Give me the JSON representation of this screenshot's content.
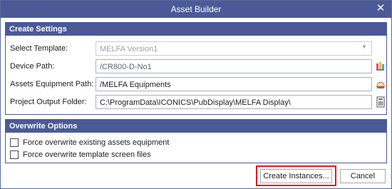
{
  "window": {
    "title": "Asset Builder",
    "close_symbol": "✕"
  },
  "create_settings": {
    "header": "Create Settings",
    "select_template": {
      "label": "Select Template:",
      "value": "MELFA Version1"
    },
    "device_path": {
      "label": "Device Path:",
      "value": "/CR800-D-No1"
    },
    "assets_equipment_path": {
      "label": "Assets Equipment Path:",
      "value": "/MELFA Equipments"
    },
    "project_output_folder": {
      "label": "Project Output Folder:",
      "value": "C:\\ProgramData\\ICONICS\\PubDisplay\\MELFA Display\\"
    }
  },
  "overwrite_options": {
    "header": "Overwrite Options",
    "force_assets": {
      "label": "Force overwrite existing assets equipment",
      "checked": false
    },
    "force_screens": {
      "label": "Force overwrite template screen files",
      "checked": false
    }
  },
  "buttons": {
    "create": "Create Instances...",
    "cancel": "Cancel"
  },
  "icons": {
    "device_path": "device-tag-icon",
    "assets_path": "asset-tree-icon",
    "output_folder": "folder-browse-icon",
    "template_dropdown": "dropdown-arrow-icon"
  },
  "colors": {
    "accent": "#4b5a97",
    "highlight": "#e0191f"
  }
}
